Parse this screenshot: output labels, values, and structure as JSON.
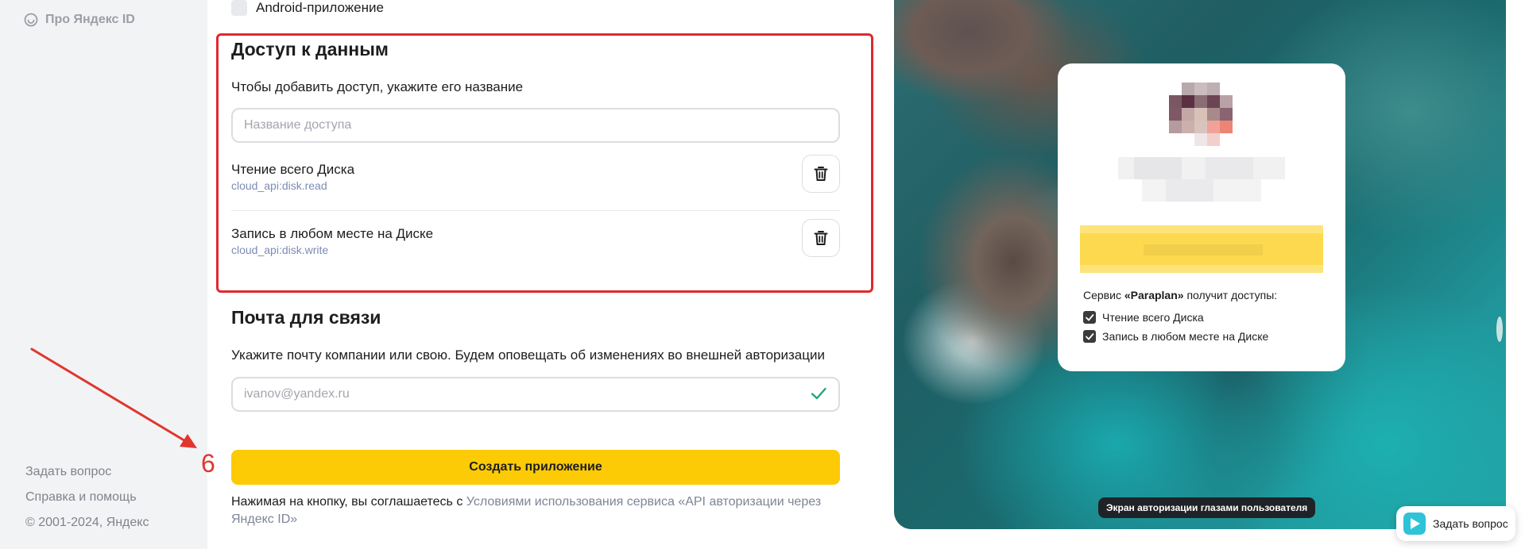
{
  "sidebar": {
    "top_link": "Про Яндекс ID",
    "ask_question": "Задать вопрос",
    "help": "Справка и помощь",
    "copyright": "© 2001-2024, Яндекс"
  },
  "platforms": {
    "android_label": "Android-приложение",
    "android_checked": false
  },
  "data_access": {
    "title": "Доступ к данным",
    "subtitle": "Чтобы добавить доступ, укажите его название",
    "input_placeholder": "Название доступа",
    "input_value": "",
    "scopes": [
      {
        "title": "Чтение всего Диска",
        "code": "cloud_api:disk.read",
        "icon": "trash-icon"
      },
      {
        "title": "Запись в любом месте на Диске",
        "code": "cloud_api:disk.write",
        "icon": "trash-icon"
      }
    ]
  },
  "contact": {
    "title": "Почта для связи",
    "subtitle": "Укажите почту компании или свою. Будем оповещать об изменениях во внешней авторизации",
    "email_placeholder": "ivanov@yandex.ru",
    "email_value": "",
    "valid_icon": "check-icon"
  },
  "actions": {
    "create_label": "Создать приложение",
    "create_color": "#fccb06",
    "terms_prefix": "Нажимая на кнопку, вы соглашаетесь с ",
    "terms_link": "Условиями использования сервиса «API авторизации через Яндекс ID»"
  },
  "annotation": {
    "step_number": "6",
    "color": "#e0362e"
  },
  "preview": {
    "service_prefix": "Сервис ",
    "service_name": "«Paraplan»",
    "service_suffix": " получит доступы:",
    "permissions": [
      {
        "label": "Чтение всего Диска",
        "checked": true
      },
      {
        "label": "Запись в любом месте на Диске",
        "checked": true
      }
    ],
    "caption": "Экран авторизации глазами пользователя"
  },
  "help_widget": {
    "label": "Задать вопрос"
  }
}
